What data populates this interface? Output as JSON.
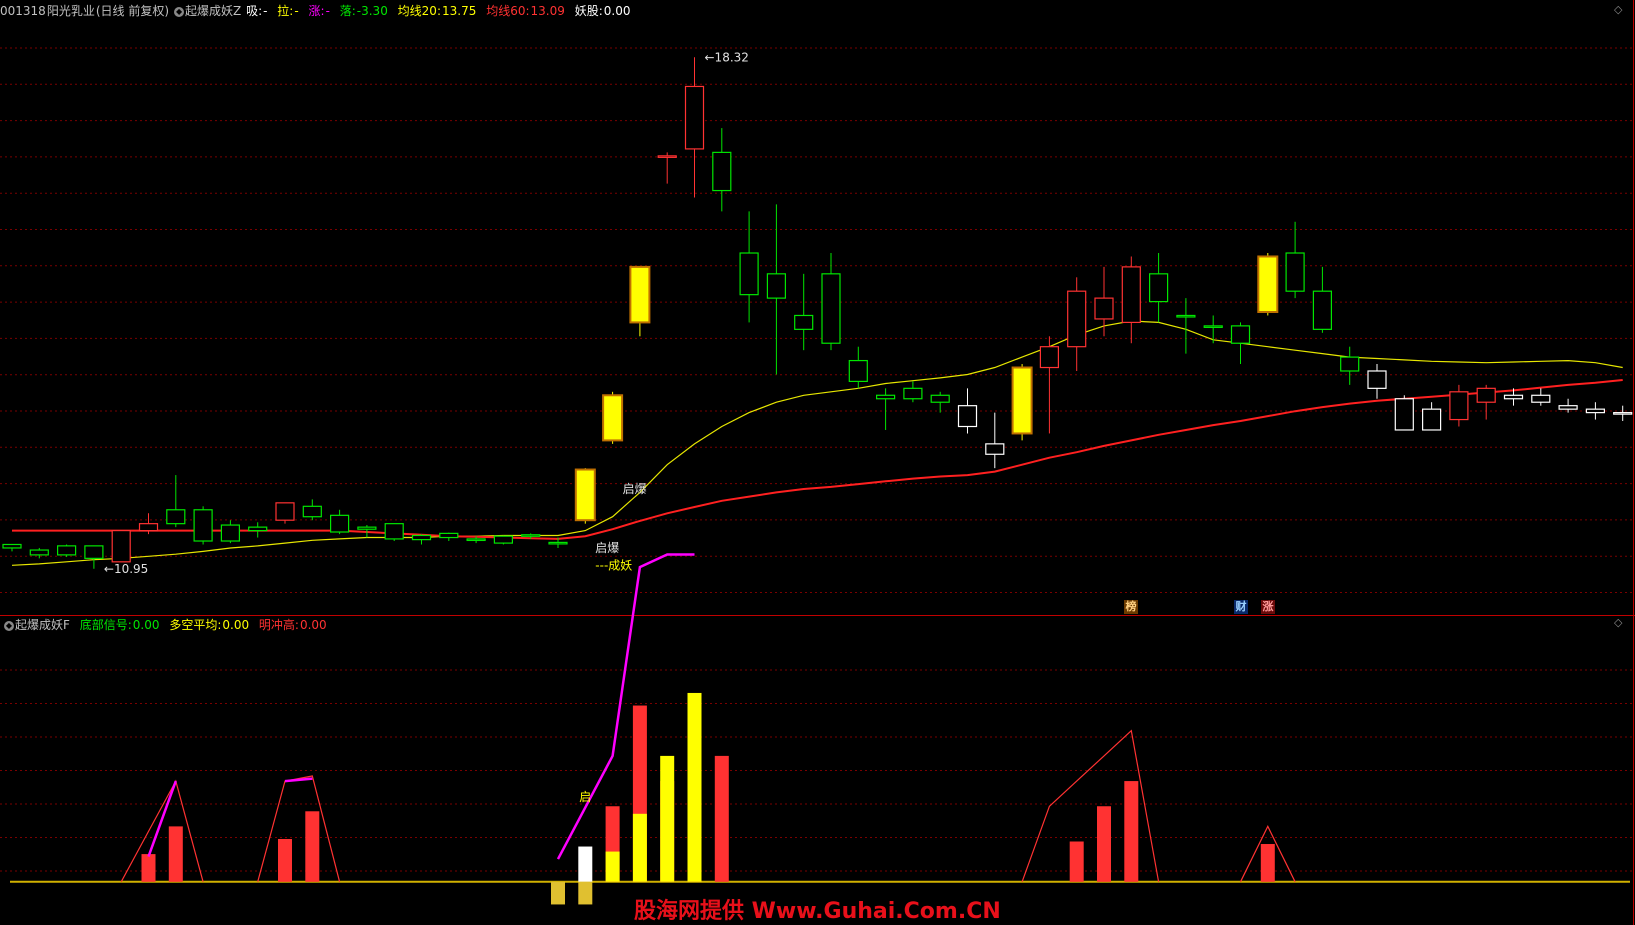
{
  "header_main": {
    "code": "001318",
    "name": "阳光乳业",
    "period": "(日线 前复权)",
    "indicator": "起爆成妖Z",
    "xi_label": "吸:",
    "xi_value": "-",
    "la_label": "拉:",
    "la_value": "-",
    "zhang_label": "涨:",
    "zhang_value": "-",
    "luo_label": "落:",
    "luo_value": "-3.30",
    "ma20_label": "均线20:",
    "ma20_value": "13.75",
    "ma60_label": "均线60:",
    "ma60_value": "13.09",
    "yao_label": "妖股:",
    "yao_value": "0.00"
  },
  "header_sub": {
    "indicator": "起爆成妖F",
    "bottom_label": "底部信号:",
    "bottom_value": "0.00",
    "dk_label": "多空平均:",
    "dk_value": "0.00",
    "mc_label": "明冲高:",
    "mc_value": "0.00"
  },
  "badges": {
    "bang": "榜",
    "cai": "财",
    "zhang": "涨"
  },
  "watermark": "股海网提供 Www.Guhai.Com.CN",
  "colors": {
    "up": "#ff3232",
    "down": "#00e600",
    "signal": "#ffff00",
    "ma20": "#e6e600",
    "ma60": "#ff2020",
    "magenta": "#ff00ff",
    "grid": "#7a0000",
    "neutral": "#ffffff"
  },
  "chart_data": [
    {
      "type": "candlestick",
      "title": "起爆成妖Z",
      "price_range": [
        10.5,
        18.8
      ],
      "annotations": [
        {
          "text": "18.32",
          "bar": 25,
          "value": 18.32
        },
        {
          "text": "10.95",
          "bar": 3,
          "value": 10.95
        },
        {
          "text": "启爆",
          "bar": 22,
          "value": 12.1
        },
        {
          "text": "启爆",
          "bar": 21,
          "value": 11.25
        },
        {
          "text": "---成妖",
          "bar": 21,
          "value": 11.0
        }
      ],
      "candles": [
        {
          "o": 11.25,
          "h": 11.3,
          "l": 11.2,
          "c": 11.3,
          "k": "d"
        },
        {
          "o": 11.15,
          "h": 11.25,
          "l": 11.1,
          "c": 11.22,
          "k": "d"
        },
        {
          "o": 11.15,
          "h": 11.3,
          "l": 11.12,
          "c": 11.28,
          "k": "d"
        },
        {
          "o": 11.1,
          "h": 11.28,
          "l": 10.95,
          "c": 11.28,
          "k": "d"
        },
        {
          "o": 11.05,
          "h": 11.5,
          "l": 11.05,
          "c": 11.5,
          "k": "u"
        },
        {
          "o": 11.5,
          "h": 11.75,
          "l": 11.45,
          "c": 11.6,
          "k": "u"
        },
        {
          "o": 11.6,
          "h": 12.3,
          "l": 11.55,
          "c": 11.8,
          "k": "d"
        },
        {
          "o": 11.8,
          "h": 11.85,
          "l": 11.3,
          "c": 11.35,
          "k": "d"
        },
        {
          "o": 11.35,
          "h": 11.65,
          "l": 11.32,
          "c": 11.58,
          "k": "d"
        },
        {
          "o": 11.55,
          "h": 11.62,
          "l": 11.4,
          "c": 11.5,
          "k": "d"
        },
        {
          "o": 11.65,
          "h": 11.9,
          "l": 11.6,
          "c": 11.9,
          "k": "u"
        },
        {
          "o": 11.7,
          "h": 11.95,
          "l": 11.65,
          "c": 11.85,
          "k": "d"
        },
        {
          "o": 11.72,
          "h": 11.8,
          "l": 11.45,
          "c": 11.48,
          "k": "d"
        },
        {
          "o": 11.52,
          "h": 11.58,
          "l": 11.4,
          "c": 11.55,
          "k": "d"
        },
        {
          "o": 11.38,
          "h": 11.6,
          "l": 11.35,
          "c": 11.6,
          "k": "d"
        },
        {
          "o": 11.37,
          "h": 11.45,
          "l": 11.3,
          "c": 11.43,
          "k": "d"
        },
        {
          "o": 11.4,
          "h": 11.47,
          "l": 11.35,
          "c": 11.46,
          "k": "d"
        },
        {
          "o": 11.38,
          "h": 11.42,
          "l": 11.32,
          "c": 11.36,
          "k": "d"
        },
        {
          "o": 11.32,
          "h": 11.43,
          "l": 11.3,
          "c": 11.42,
          "k": "d"
        },
        {
          "o": 11.42,
          "h": 11.46,
          "l": 11.38,
          "c": 11.44,
          "k": "d"
        },
        {
          "o": 11.32,
          "h": 11.4,
          "l": 11.25,
          "c": 11.33,
          "k": "d"
        },
        {
          "o": 11.65,
          "h": 12.4,
          "l": 11.6,
          "c": 12.38,
          "k": "s"
        },
        {
          "o": 12.8,
          "h": 13.5,
          "l": 12.75,
          "c": 13.45,
          "k": "s"
        },
        {
          "o": 14.5,
          "h": 15.3,
          "l": 14.3,
          "c": 15.3,
          "k": "s"
        },
        {
          "o": 16.9,
          "h": 16.95,
          "l": 16.5,
          "c": 16.9,
          "k": "u"
        },
        {
          "o": 17.0,
          "h": 18.32,
          "l": 16.3,
          "c": 17.9,
          "k": "u"
        },
        {
          "o": 16.95,
          "h": 17.3,
          "l": 16.1,
          "c": 16.4,
          "k": "d"
        },
        {
          "o": 15.5,
          "h": 16.1,
          "l": 14.5,
          "c": 14.9,
          "k": "d"
        },
        {
          "o": 15.2,
          "h": 16.2,
          "l": 13.75,
          "c": 14.85,
          "k": "d"
        },
        {
          "o": 14.4,
          "h": 15.2,
          "l": 14.1,
          "c": 14.6,
          "k": "d"
        },
        {
          "o": 15.2,
          "h": 15.5,
          "l": 14.1,
          "c": 14.2,
          "k": "d"
        },
        {
          "o": 13.95,
          "h": 14.15,
          "l": 13.55,
          "c": 13.65,
          "k": "d"
        },
        {
          "o": 13.45,
          "h": 13.55,
          "l": 12.95,
          "c": 13.4,
          "k": "d"
        },
        {
          "o": 13.55,
          "h": 13.65,
          "l": 13.35,
          "c": 13.4,
          "k": "d"
        },
        {
          "o": 13.45,
          "h": 13.5,
          "l": 13.2,
          "c": 13.35,
          "k": "d"
        },
        {
          "o": 13.0,
          "h": 13.55,
          "l": 12.9,
          "c": 13.3,
          "k": "n"
        },
        {
          "o": 12.6,
          "h": 13.2,
          "l": 12.4,
          "c": 12.75,
          "k": "n"
        },
        {
          "o": 12.9,
          "h": 13.9,
          "l": 12.8,
          "c": 13.85,
          "k": "s"
        },
        {
          "o": 13.85,
          "h": 14.3,
          "l": 12.9,
          "c": 14.15,
          "k": "u"
        },
        {
          "o": 14.15,
          "h": 15.15,
          "l": 13.8,
          "c": 14.95,
          "k": "u"
        },
        {
          "o": 14.55,
          "h": 15.3,
          "l": 14.3,
          "c": 14.85,
          "k": "u"
        },
        {
          "o": 14.5,
          "h": 15.45,
          "l": 14.2,
          "c": 15.3,
          "k": "u"
        },
        {
          "o": 15.2,
          "h": 15.5,
          "l": 14.5,
          "c": 14.8,
          "k": "d"
        },
        {
          "o": 14.6,
          "h": 14.85,
          "l": 14.05,
          "c": 14.6,
          "k": "d"
        },
        {
          "o": 14.45,
          "h": 14.6,
          "l": 14.2,
          "c": 14.45,
          "k": "d"
        },
        {
          "o": 14.45,
          "h": 14.5,
          "l": 13.9,
          "c": 14.2,
          "k": "d"
        },
        {
          "o": 14.65,
          "h": 15.5,
          "l": 14.6,
          "c": 15.45,
          "k": "s"
        },
        {
          "o": 15.5,
          "h": 15.95,
          "l": 14.85,
          "c": 14.95,
          "k": "d"
        },
        {
          "o": 14.95,
          "h": 15.3,
          "l": 14.35,
          "c": 14.4,
          "k": "d"
        },
        {
          "o": 14.0,
          "h": 14.15,
          "l": 13.6,
          "c": 13.8,
          "k": "d"
        },
        {
          "o": 13.8,
          "h": 13.9,
          "l": 13.4,
          "c": 13.55,
          "k": "n"
        },
        {
          "o": 13.4,
          "h": 13.45,
          "l": 12.95,
          "c": 12.95,
          "k": "n"
        },
        {
          "o": 13.25,
          "h": 13.35,
          "l": 13.0,
          "c": 12.95,
          "k": "n"
        },
        {
          "o": 13.5,
          "h": 13.6,
          "l": 13.0,
          "c": 13.1,
          "k": "u"
        },
        {
          "o": 13.35,
          "h": 13.6,
          "l": 13.1,
          "c": 13.55,
          "k": "u"
        },
        {
          "o": 13.45,
          "h": 13.55,
          "l": 13.3,
          "c": 13.4,
          "k": "n"
        },
        {
          "o": 13.45,
          "h": 13.55,
          "l": 13.3,
          "c": 13.35,
          "k": "n"
        },
        {
          "o": 13.3,
          "h": 13.4,
          "l": 13.2,
          "c": 13.25,
          "k": "n"
        },
        {
          "o": 13.2,
          "h": 13.35,
          "l": 13.1,
          "c": 13.25,
          "k": "n"
        },
        {
          "o": 13.2,
          "h": 13.3,
          "l": 13.08,
          "c": 13.2,
          "k": "n"
        }
      ],
      "ma20": [
        11.0,
        11.02,
        11.05,
        11.08,
        11.1,
        11.13,
        11.16,
        11.2,
        11.25,
        11.28,
        11.32,
        11.36,
        11.38,
        11.4,
        11.4,
        11.4,
        11.42,
        11.42,
        11.43,
        11.43,
        11.43,
        11.5,
        11.7,
        12.05,
        12.45,
        12.75,
        13.0,
        13.2,
        13.35,
        13.45,
        13.5,
        13.55,
        13.62,
        13.66,
        13.7,
        13.75,
        13.85,
        14.0,
        14.15,
        14.32,
        14.45,
        14.52,
        14.5,
        14.4,
        14.25,
        14.2,
        14.15,
        14.1,
        14.05,
        14.0,
        13.98,
        13.96,
        13.94,
        13.93,
        13.92,
        13.93,
        13.94,
        13.95,
        13.92,
        13.85
      ],
      "ma60": [
        11.5,
        11.5,
        11.5,
        11.5,
        11.5,
        11.5,
        11.5,
        11.5,
        11.5,
        11.5,
        11.5,
        11.5,
        11.5,
        11.48,
        11.46,
        11.44,
        11.42,
        11.41,
        11.4,
        11.39,
        11.38,
        11.42,
        11.52,
        11.64,
        11.75,
        11.84,
        11.93,
        11.99,
        12.05,
        12.1,
        12.13,
        12.17,
        12.21,
        12.25,
        12.28,
        12.3,
        12.35,
        12.45,
        12.55,
        12.63,
        12.72,
        12.8,
        12.88,
        12.95,
        13.02,
        13.08,
        13.15,
        13.22,
        13.28,
        13.33,
        13.37,
        13.4,
        13.43,
        13.46,
        13.49,
        13.52,
        13.56,
        13.6,
        13.63,
        13.67
      ]
    },
    {
      "type": "bar",
      "title": "起爆成妖F",
      "annotation": {
        "text": "启",
        "bar": 21
      },
      "value_range": [
        -1.2,
        10.0
      ],
      "red_bars": [
        {
          "bar": 5,
          "v": 1.1
        },
        {
          "bar": 6,
          "v": 2.2
        },
        {
          "bar": 10,
          "v": 1.7
        },
        {
          "bar": 11,
          "v": 2.8
        },
        {
          "bar": 22,
          "v": 3.0
        },
        {
          "bar": 23,
          "v": 7.0
        },
        {
          "bar": 24,
          "v": 4.0
        },
        {
          "bar": 25,
          "v": 6.0
        },
        {
          "bar": 26,
          "v": 5.0
        },
        {
          "bar": 39,
          "v": 1.6
        },
        {
          "bar": 40,
          "v": 3.0
        },
        {
          "bar": 41,
          "v": 4.0
        },
        {
          "bar": 46,
          "v": 1.5
        }
      ],
      "yellow_bars": [
        {
          "bar": 22,
          "v": 1.2
        },
        {
          "bar": 23,
          "v": 2.7
        },
        {
          "bar": 24,
          "v": 5.0
        },
        {
          "bar": 25,
          "v": 7.5
        }
      ],
      "white_bars": [
        {
          "bar": 21,
          "v": 1.4
        }
      ],
      "neg_bars": [
        {
          "bar": 20,
          "v": -0.9
        },
        {
          "bar": 21,
          "v": -0.9
        }
      ],
      "magenta_lines": [
        [
          [
            5,
            1.0
          ],
          [
            6,
            4.0
          ]
        ],
        [
          [
            10,
            4.0
          ],
          [
            11,
            4.1
          ]
        ],
        [
          [
            20,
            0.9
          ],
          [
            22,
            5.0
          ],
          [
            23,
            12.5
          ],
          [
            24,
            13.0
          ],
          [
            25,
            13.0
          ]
        ]
      ],
      "red_envelopes": [
        [
          [
            4,
            0
          ],
          [
            5,
            2.0
          ],
          [
            6,
            4.0
          ],
          [
            7,
            0
          ]
        ],
        [
          [
            9,
            0
          ],
          [
            10,
            4.0
          ],
          [
            11,
            4.2
          ],
          [
            12,
            0
          ]
        ],
        [
          [
            37,
            0
          ],
          [
            38,
            3.0
          ],
          [
            39,
            4.0
          ],
          [
            40,
            5.0
          ],
          [
            41,
            6.0
          ],
          [
            42,
            0
          ]
        ],
        [
          [
            45,
            0
          ],
          [
            46,
            2.2
          ],
          [
            47,
            0
          ]
        ]
      ]
    }
  ]
}
